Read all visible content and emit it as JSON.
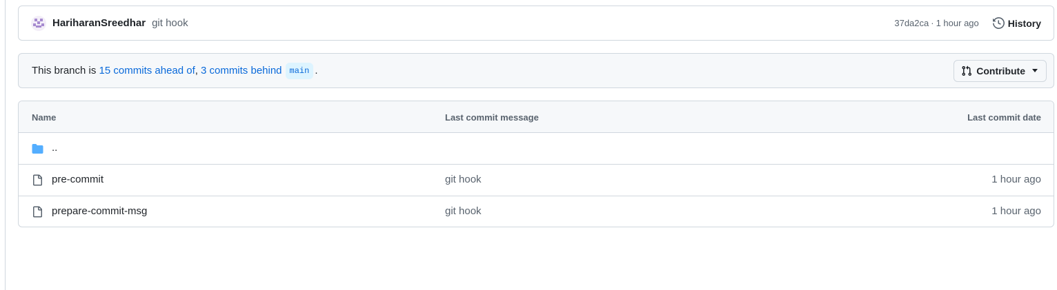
{
  "commit": {
    "author": "HariharanSreedhar",
    "message": "git hook",
    "sha": "37da2ca",
    "separator": "·",
    "time_ago": "1 hour ago",
    "history_label": "History"
  },
  "branch_status": {
    "prefix": "This branch is ",
    "ahead_link": "15 commits ahead of",
    "comma": ",",
    "behind_link": "3 commits behind",
    "base_branch": "main",
    "suffix": ".",
    "contribute_label": "Contribute"
  },
  "table": {
    "headers": {
      "name": "Name",
      "message": "Last commit message",
      "date": "Last commit date"
    },
    "parent_dir": "..",
    "rows": [
      {
        "name": "pre-commit",
        "message": "git hook",
        "date": "1 hour ago"
      },
      {
        "name": "prepare-commit-msg",
        "message": "git hook",
        "date": "1 hour ago"
      }
    ]
  },
  "colors": {
    "accent": "#0969da",
    "folder": "#54aeff",
    "border": "#d0d7de",
    "muted_text": "#59636e",
    "subtle_bg": "#f6f8fa"
  }
}
